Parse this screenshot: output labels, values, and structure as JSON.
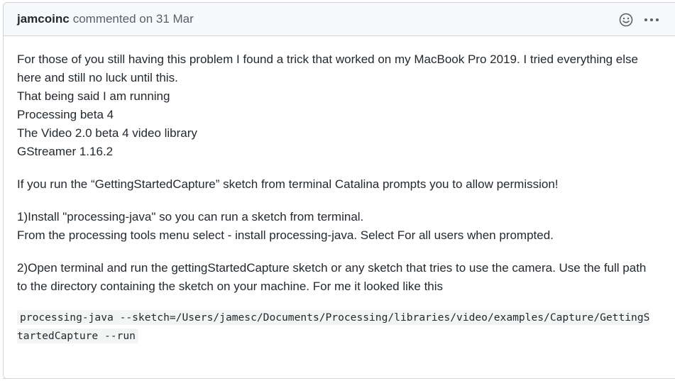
{
  "comment": {
    "author": "jamcoinc",
    "meta": "commented on 31 Mar",
    "icons": {
      "reaction": "smiley-icon",
      "menu": "kebab-horizontal-icon"
    },
    "body": {
      "intro": "For those of you still having this problem I found a trick that worked on my MacBook Pro 2019. I tried everything else here and still no luck until this.",
      "setup_lines": [
        "That being said I am running",
        "Processing beta 4",
        "The Video 2.0 beta 4 video library",
        "GStreamer 1.16.2"
      ],
      "catalina_note": "If you run the “GettingStartedCapture” sketch from terminal Catalina prompts you to allow permission!",
      "step1_line1": "1)Install \"processing-java\" so you can run a sketch from terminal.",
      "step1_line2": "From the processing tools menu select - install processing-java. Select For all users when prompted.",
      "step2": "2)Open terminal and run the gettingStartedCapture sketch or any sketch that tries to use the camera. Use the full path to the directory containing the sketch on your machine. For me it looked like this",
      "code": "processing-java --sketch=/Users/jamesc/Documents/Processing/libraries/video/examples/Capture/GettingStartedCapture --run"
    }
  }
}
